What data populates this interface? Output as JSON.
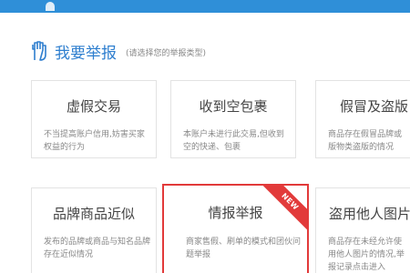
{
  "header": {
    "title": "我要举报",
    "subtitle": "(请选择您的举报类型)"
  },
  "cards": [
    {
      "title": "虚假交易",
      "desc": "不当提高账户信用,妨害买家权益的行为"
    },
    {
      "title": "收到空包裹",
      "desc": "本账户未进行此交易,但收到空的快递、包裹"
    },
    {
      "title": "假冒及盗版",
      "desc": "商品存在假冒品牌或版物类盗版的情况"
    },
    {
      "title": "品牌商品近似",
      "desc": "发布的品牌或商品与知名品牌存在近似情况"
    },
    {
      "title": "情报举报",
      "desc": "商家售假、刷单的模式和团伙问题举报",
      "badge": "NEW"
    },
    {
      "title": "盗用他人图片",
      "desc": "商品存在未经允许使用他人图片的情况,举报记录点击进入"
    }
  ],
  "colors": {
    "topbar": "#2f8fd8",
    "accent": "#2f7fcf",
    "highlight": "#e23a3a"
  }
}
